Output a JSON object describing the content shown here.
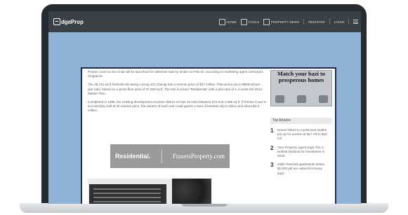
{
  "header": {
    "logo_text": "dgeProp",
    "nav": [
      {
        "label": "HOME",
        "icon": "home-icon"
      },
      {
        "label": "TOOLS",
        "icon": "tools-icon"
      },
      {
        "label": "PROPERTY NEWS",
        "icon": "news-icon"
      },
      {
        "label": "REGISTER"
      },
      {
        "label": "LOGIN"
      }
    ]
  },
  "article": {
    "paragraphs": [
      "Pomex Court at Joo Chiat will be launched for collective sale by tender on Feb 22, according to marketing agent Century21 Singapore.",
      "The 26,741 sq ft freehold site along Lorong 101 Changi has a reserve price of $37 million. That works out to $998 psf per plot ratio, based on a gross floor area of 37,059 sq ft. The site is zoned \"Residential\" with a plot ratio of 1.4 under the 2014 Master Plan.",
      "Completed in 1986, the existing development at prime district 15 has 19 units between 872 and 1,668 sq ft. If Pomex Court is successfully sold at its reserve price, the owners of each unit could garner a sum of between $1.5 million and about $2.3 million."
    ],
    "banner_left": "Residential.",
    "banner_right": "FrasersProperty.com"
  },
  "sidebar": {
    "ad_text": "Match your bazi to prosperous homes",
    "top_articles_title": "Top Articles",
    "items": [
      {
        "num": "1",
        "text": "House linked to mysterious deaths put up for auction at $17 mil to $18 mil"
      },
      {
        "num": "2",
        "text": "Your Property Agent Says The 3 Hottest Districts for Investment in 2018"
      },
      {
        "num": "3",
        "text": "Older freehold apartments below $1,000 psf are value-for-money buys"
      }
    ]
  },
  "colors": {
    "wallpaper": "#8fb3d4",
    "header_bar": "#3b4046",
    "card_border": "#1f2a56"
  }
}
